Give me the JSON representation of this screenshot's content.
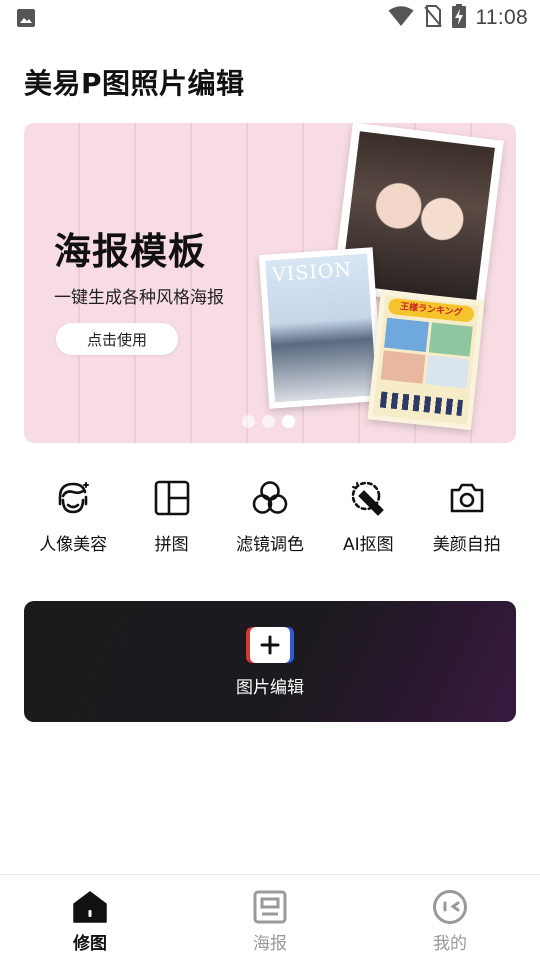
{
  "status_bar": {
    "time": "11:08",
    "left_icon": "image-icon",
    "icons": [
      "wifi-icon",
      "no-sim-icon",
      "battery-charging-icon"
    ]
  },
  "header": {
    "title": "美易P图照片编辑"
  },
  "banner": {
    "title": "海报模板",
    "subtitle": "一键生成各种风格海报",
    "button_label": "点击使用",
    "magazine_text": "VISION",
    "manga_text": "王様ランキング",
    "slides": 3,
    "active_slide": 3
  },
  "tools": [
    {
      "label": "人像美容",
      "icon": "face-beauty-icon"
    },
    {
      "label": "拼图",
      "icon": "collage-icon"
    },
    {
      "label": "滤镜调色",
      "icon": "filter-circles-icon"
    },
    {
      "label": "AI抠图",
      "icon": "ai-cutout-icon"
    },
    {
      "label": "美颜自拍",
      "icon": "camera-icon"
    }
  ],
  "edit_card": {
    "label": "图片编辑",
    "icon": "plus-icon"
  },
  "bottom_nav": [
    {
      "label": "修图",
      "icon": "home-icon",
      "active": true
    },
    {
      "label": "海报",
      "icon": "poster-icon",
      "active": false
    },
    {
      "label": "我的",
      "icon": "profile-icon",
      "active": false
    }
  ],
  "colors": {
    "banner_bg": "#f7dde3",
    "edit_card_bg": "#1b1b1d",
    "edit_card_accent": "#3a1a40",
    "nav_active": "#111111",
    "nav_inactive": "#999999",
    "plus_red": "#d6362f",
    "plus_blue": "#2f5bd6"
  }
}
